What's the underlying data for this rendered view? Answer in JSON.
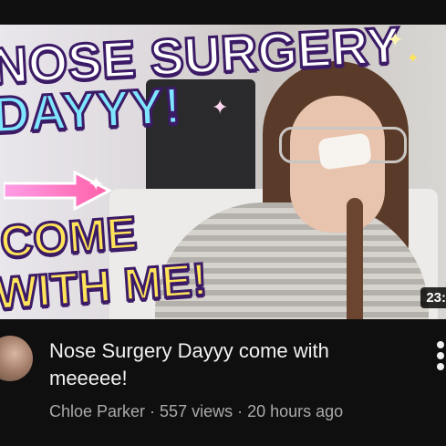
{
  "video": {
    "thumbnail_text": {
      "line1": "NOSE SURGERY",
      "line2": "DAYYY!",
      "line3": "COME",
      "line4": "WITH ME!"
    },
    "duration": "23:",
    "title": "Nose Surgery Dayyy come with meeeee!",
    "channel": "Chloe Parker",
    "separator": " · ",
    "views": "557 views",
    "age": "20 hours ago"
  },
  "icons": {
    "menu": "more-vert-icon",
    "arrow": "arrow-right-icon",
    "sparkle": "sparkle-icon"
  },
  "colors": {
    "background": "#0f0f0f",
    "title": "#f1f1f1",
    "meta": "#aaaaaa",
    "thumb_text_white": "#ffffff",
    "thumb_text_cyan": "#7fe6ff",
    "thumb_text_yellow": "#ffe45a",
    "thumb_text_outline": "#3b1a66"
  }
}
